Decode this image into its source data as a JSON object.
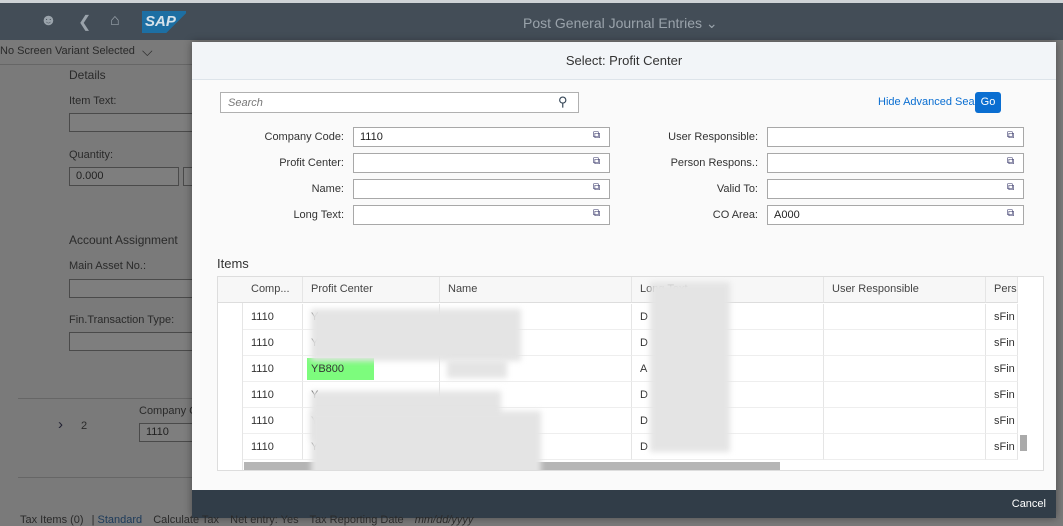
{
  "shell": {
    "title": "Post General Journal Entries",
    "logo": "SAP",
    "icons": [
      "user-icon",
      "back-icon",
      "home-icon"
    ]
  },
  "background": {
    "variant": "No Screen Variant Selected",
    "details": "Details",
    "item_text": "Item Text:",
    "quantity": "Quantity:",
    "quantity_value": "0.000",
    "account_assignment": "Account Assignment",
    "main_asset": "Main Asset No.:",
    "fin_trans": "Fin.Transaction Type:",
    "row_num": "2",
    "company": "Company C",
    "company_value": "1110",
    "tax_items": "Tax Items (0)",
    "standard": "Standard",
    "calc_tax": "Calculate Tax",
    "net_entry": "Net entry: Yes",
    "tax_date": "Tax Reporting Date",
    "date_placeholder": "mm/dd/yyyy"
  },
  "dialog": {
    "title": "Select: Profit Center",
    "search_placeholder": "Search",
    "hide_adv": "Hide Advanced Search",
    "go": "Go",
    "cancel": "Cancel",
    "fields_left": [
      {
        "label": "Company Code:",
        "value": "1110"
      },
      {
        "label": "Profit Center:",
        "value": ""
      },
      {
        "label": "Name:",
        "value": ""
      },
      {
        "label": "Long Text:",
        "value": ""
      }
    ],
    "fields_right": [
      {
        "label": "User Responsible:",
        "value": ""
      },
      {
        "label": "Person Respons.:",
        "value": ""
      },
      {
        "label": "Valid To:",
        "value": ""
      },
      {
        "label": "CO Area:",
        "value": "A000"
      }
    ],
    "items_title": "Items",
    "columns": [
      "Comp...",
      "Profit Center",
      "Name",
      "Long Text",
      "User Responsible",
      "Pers"
    ],
    "rows": [
      {
        "comp": "1110",
        "pc": "Y",
        "name": "",
        "long": "D",
        "user": "",
        "pers": "sFin"
      },
      {
        "comp": "1110",
        "pc": "Y",
        "name": "",
        "long": "D",
        "user": "",
        "pers": "sFin"
      },
      {
        "comp": "1110",
        "pc": "YB800",
        "name": "",
        "long": "A",
        "user": "",
        "pers": "sFin",
        "highlight": true
      },
      {
        "comp": "1110",
        "pc": "Y",
        "name": "",
        "long": "D",
        "user": "",
        "pers": "sFin"
      },
      {
        "comp": "1110",
        "pc": "Y",
        "name": "",
        "long": "D",
        "user": "",
        "pers": "sFin"
      },
      {
        "comp": "1110",
        "pc": "Y",
        "name": "",
        "long": "D",
        "user": "",
        "pers": "sFin"
      }
    ],
    "highlight_color": "#7dfc7d"
  }
}
